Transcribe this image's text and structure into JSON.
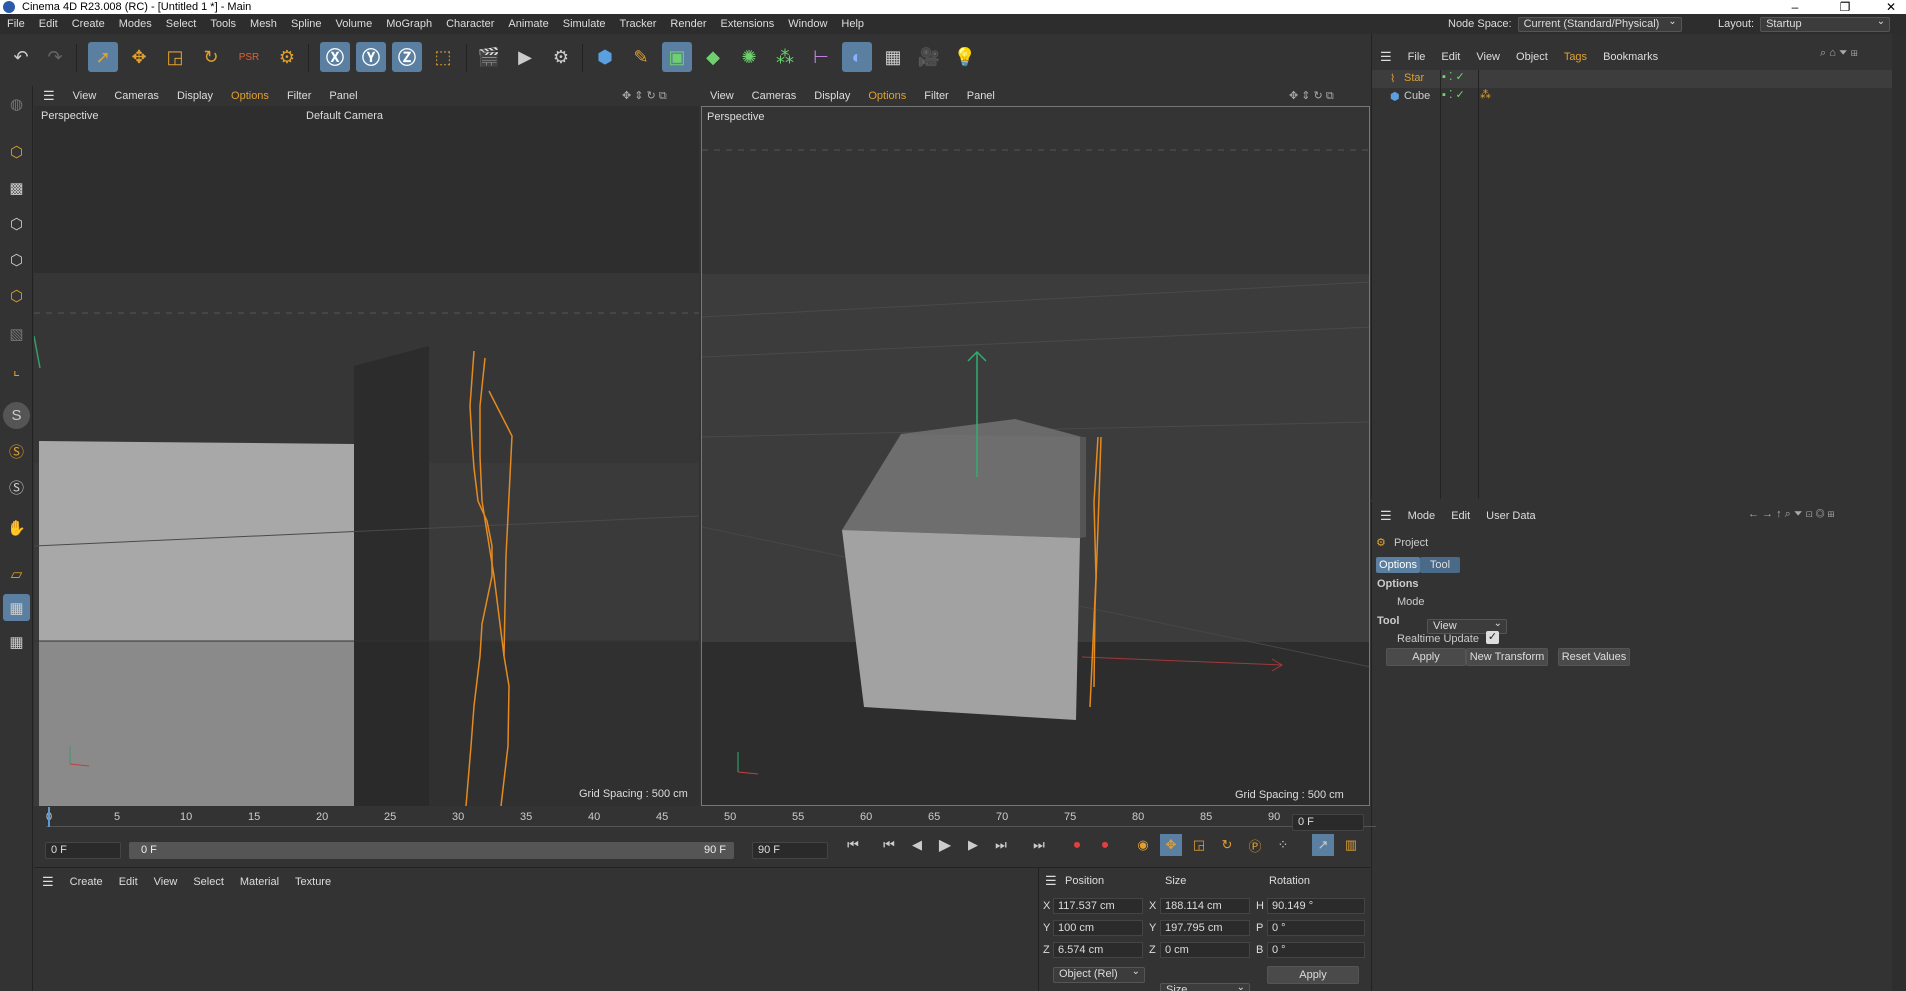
{
  "window": {
    "title": "Cinema 4D R23.008 (RC) - [Untitled 1 *] - Main"
  },
  "menubar": {
    "items": [
      "File",
      "Edit",
      "Create",
      "Modes",
      "Select",
      "Tools",
      "Mesh",
      "Spline",
      "Volume",
      "MoGraph",
      "Character",
      "Animate",
      "Simulate",
      "Tracker",
      "Render",
      "Extensions",
      "Window",
      "Help"
    ],
    "node_space_label": "Node Space:",
    "node_space_value": "Current (Standard/Physical)",
    "layout_label": "Layout:",
    "layout_value": "Startup"
  },
  "viewport_left": {
    "menu": [
      "View",
      "Cameras",
      "Display",
      "Options",
      "Filter",
      "Panel"
    ],
    "label": "Perspective",
    "camera": "Default Camera",
    "grid": "Grid Spacing : 500 cm"
  },
  "viewport_right": {
    "menu": [
      "View",
      "Cameras",
      "Display",
      "Options",
      "Filter",
      "Panel"
    ],
    "label": "Perspective",
    "grid": "Grid Spacing : 500 cm"
  },
  "object_manager": {
    "menu": [
      "File",
      "Edit",
      "View",
      "Object",
      "Tags",
      "Bookmarks"
    ],
    "objects": [
      {
        "name": "Star"
      },
      {
        "name": "Cube"
      }
    ]
  },
  "attributes": {
    "menu": [
      "Mode",
      "Edit",
      "User Data"
    ],
    "title": "Project",
    "tabs": [
      "Options",
      "Tool"
    ],
    "options_header": "Options",
    "mode_label": "Mode",
    "mode_value": "View",
    "tool_header": "Tool",
    "realtime_label": "Realtime Update",
    "buttons": [
      "Apply",
      "New Transform",
      "Reset Values"
    ]
  },
  "timeline": {
    "ticks": [
      "0",
      "5",
      "10",
      "15",
      "20",
      "25",
      "30",
      "35",
      "40",
      "45",
      "50",
      "55",
      "60",
      "65",
      "70",
      "75",
      "80",
      "85",
      "90"
    ],
    "current_frame": "0 F",
    "start_field": "0 F",
    "range_start": "0 F",
    "range_end": "90 F",
    "end_field": "90 F"
  },
  "material_manager": {
    "menu": [
      "Create",
      "Edit",
      "View",
      "Select",
      "Material",
      "Texture"
    ]
  },
  "coordinates": {
    "headers": [
      "Position",
      "Size",
      "Rotation"
    ],
    "rows": [
      {
        "axis": "X",
        "pos": "117.537 cm",
        "saxis": "X",
        "size": "188.114 cm",
        "raxis": "H",
        "rot": "90.149 °"
      },
      {
        "axis": "Y",
        "pos": "100 cm",
        "saxis": "Y",
        "size": "197.795 cm",
        "raxis": "P",
        "rot": "0 °"
      },
      {
        "axis": "Z",
        "pos": "6.574 cm",
        "saxis": "Z",
        "size": "0 cm",
        "raxis": "B",
        "rot": "0 °"
      }
    ],
    "mode_value": "Object (Rel)",
    "size_value": "Size",
    "apply": "Apply"
  },
  "colors": {
    "accent_orange": "#e0a030",
    "select_blue": "#5a7fa0",
    "spline": "#e58a1f"
  }
}
